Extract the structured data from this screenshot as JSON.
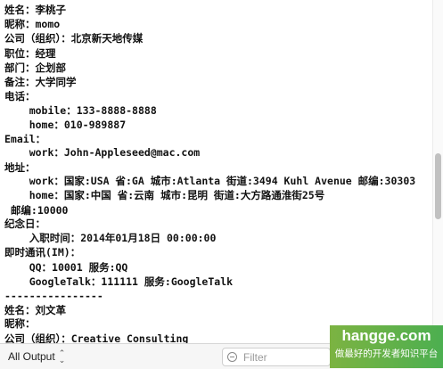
{
  "console": {
    "lines": [
      "姓名：李桃子",
      "昵称：momo",
      "公司（组织）：北京新天地传媒",
      "职位：经理",
      "部门：企划部",
      "备注：大学同学",
      "电话：",
      "    mobile：133-8888-8888",
      "    home：010-989887",
      "Email：",
      "    work：John-Appleseed@mac.com",
      "地址：",
      "    work：国家:USA 省:GA 城市:Atlanta 街道:3494 Kuhl Avenue 邮编:30303",
      "    home：国家:中国 省:云南 城市:昆明 街道:大方路通淮街25号",
      " 邮编:10000",
      "纪念日：",
      "    入职时间：2014年01月18日 00:00:00",
      "即时通讯(IM)：",
      "    QQ：10001 服务:QQ",
      "    GoogleTalk：111111 服务:GoogleTalk",
      "----------------",
      "姓名：刘文革",
      "昵称：",
      "公司（组织）：Creative Consulting"
    ]
  },
  "bottom_bar": {
    "output_selector": "All Output",
    "filter_placeholder": "Filter"
  },
  "watermark": {
    "site": "hangge.com",
    "slogan": "做最好的开发者知识平台"
  }
}
